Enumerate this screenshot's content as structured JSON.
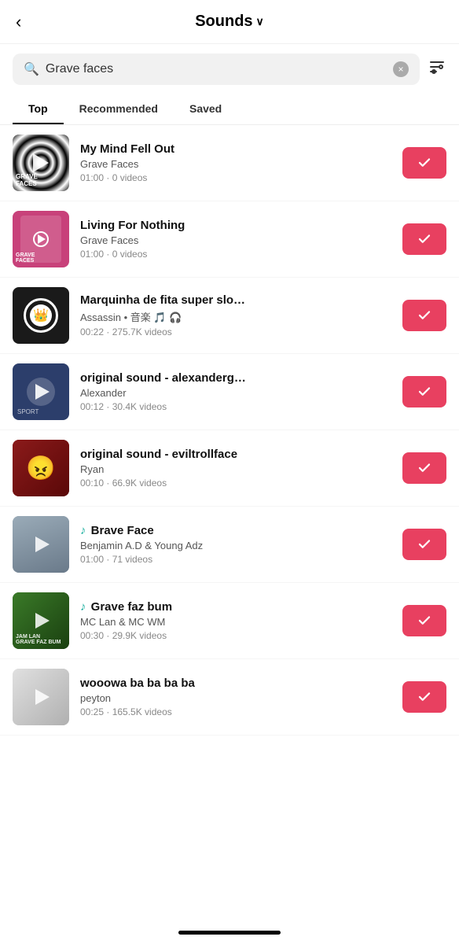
{
  "header": {
    "back_label": "<",
    "title": "Sounds",
    "chevron": "∨"
  },
  "search": {
    "placeholder": "Grave faces",
    "value": "Grave faces",
    "clear_icon": "×",
    "filter_icon": "⚙"
  },
  "tabs": [
    {
      "label": "Top",
      "active": true
    },
    {
      "label": "Recommended",
      "active": false
    },
    {
      "label": "Saved",
      "active": false
    }
  ],
  "sounds": [
    {
      "id": 1,
      "title": "My Mind Fell Out",
      "artist": "Grave Faces",
      "duration": "01:00",
      "videos": "0 videos",
      "thumb_style": "spiral",
      "thumb_label": "GRAVE FACES"
    },
    {
      "id": 2,
      "title": "Living For Nothing",
      "artist": "Grave Faces",
      "duration": "01:00",
      "videos": "0 videos",
      "thumb_style": "pink",
      "thumb_label": "GRAVE FACES"
    },
    {
      "id": 3,
      "title": "Marquinha de fita super slo…",
      "artist": "Assassin • 音楽 🎵 🎧",
      "duration": "00:22",
      "videos": "275.7K videos",
      "thumb_style": "dark",
      "thumb_label": ""
    },
    {
      "id": 4,
      "title": "original sound - alexanderg…",
      "artist": "Alexander",
      "duration": "00:12",
      "videos": "30.4K videos",
      "thumb_style": "blue-dark",
      "thumb_label": ""
    },
    {
      "id": 5,
      "title": "original sound - eviltrollface",
      "artist": "Ryan",
      "duration": "00:10",
      "videos": "66.9K videos",
      "thumb_style": "red-dark",
      "thumb_label": ""
    },
    {
      "id": 6,
      "title": "♪ Brave Face",
      "artist": "Benjamin A.D & Young Adz",
      "duration": "01:00",
      "videos": "71 videos",
      "thumb_style": "blue-grey",
      "thumb_label": ""
    },
    {
      "id": 7,
      "title": "♪ Grave faz bum",
      "artist": "MC Lan & MC WM",
      "duration": "00:30",
      "videos": "29.9K videos",
      "thumb_style": "green",
      "thumb_label": "JAM LAN\nGRAVE FAZ BUM"
    },
    {
      "id": 8,
      "title": "wooowa ba ba ba ba",
      "artist": "peyton",
      "duration": "00:25",
      "videos": "165.5K videos",
      "thumb_style": "light",
      "thumb_label": ""
    }
  ],
  "colors": {
    "check_btn": "#e84060",
    "accent": "#1db0a0"
  }
}
